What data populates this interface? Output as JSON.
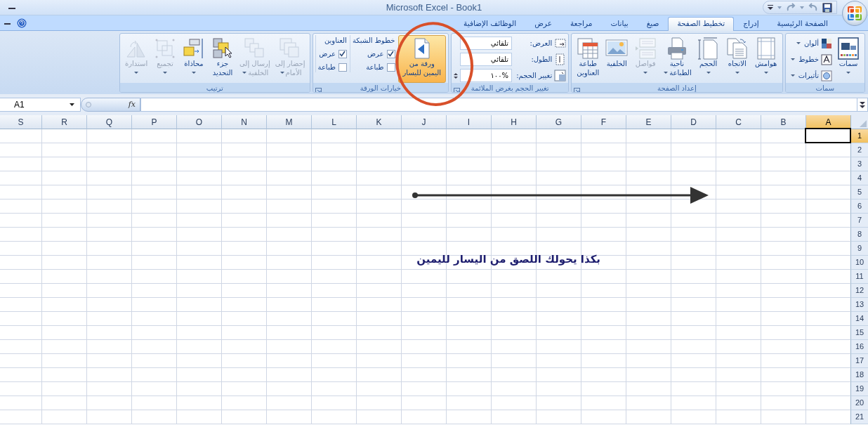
{
  "title_bar": {
    "title": "Microsoft Excel - Book1"
  },
  "tabs": [
    {
      "label": "الصفحة الرئيسية",
      "selected": false
    },
    {
      "label": "إدراج",
      "selected": false
    },
    {
      "label": "تخطيط الصفحة",
      "selected": true
    },
    {
      "label": "صيغ",
      "selected": false
    },
    {
      "label": "بيانات",
      "selected": false
    },
    {
      "label": "مراجعة",
      "selected": false
    },
    {
      "label": "عرض",
      "selected": false
    },
    {
      "label": "الوظائف الإضافية",
      "selected": false
    }
  ],
  "ribbon": {
    "groups": [
      {
        "title": "سمات",
        "launcher": false,
        "items": [
          {
            "kind": "large",
            "label": "سمات",
            "dropdown": true,
            "disabled": false,
            "highlighted": false
          },
          {
            "kind": "stack",
            "entries": [
              {
                "label": "ألوان",
                "dropdown": true
              },
              {
                "label": "خطوط",
                "dropdown": true
              },
              {
                "label": "تأثيرات",
                "dropdown": true
              }
            ]
          }
        ]
      },
      {
        "title": "إعداد الصفحة",
        "launcher": true,
        "items": [
          {
            "kind": "large",
            "label": "هوامش",
            "dropdown": true,
            "disabled": false,
            "highlighted": false
          },
          {
            "kind": "large",
            "label": "الاتجاه",
            "dropdown": true,
            "disabled": false,
            "highlighted": false
          },
          {
            "kind": "large",
            "label": "الحجم",
            "dropdown": true,
            "disabled": false,
            "highlighted": false
          },
          {
            "kind": "large",
            "label": "ناحية\nالطباعة",
            "dropdown": true,
            "disabled": false,
            "highlighted": false
          },
          {
            "kind": "large",
            "label": "فواصل",
            "dropdown": true,
            "disabled": true,
            "highlighted": false
          },
          {
            "kind": "large",
            "label": "الخلفية",
            "dropdown": false,
            "disabled": false,
            "highlighted": false
          },
          {
            "kind": "large",
            "label": "طباعة\nالعناوين",
            "dropdown": false,
            "disabled": false,
            "highlighted": false
          }
        ]
      },
      {
        "title": "تغيير الحجم بغرض الملائمة",
        "launcher": true,
        "items": [
          {
            "kind": "fields",
            "entries": [
              {
                "kind": "select",
                "label": "العرض:",
                "value": "تلقائي"
              },
              {
                "kind": "select",
                "label": "الطول:",
                "value": "تلقائي"
              },
              {
                "kind": "spin",
                "label": "تغيير الحجم:",
                "value": "%١٠٠"
              }
            ]
          }
        ]
      },
      {
        "title": "خيارات الورقة",
        "launcher": true,
        "items": [
          {
            "kind": "large",
            "label": "ورقة من\nاليمين لليسار",
            "dropdown": false,
            "disabled": false,
            "highlighted": true
          },
          {
            "kind": "options",
            "heading": "خطوط الشبكة",
            "entries": [
              {
                "label": "عرض",
                "checked": true
              },
              {
                "label": "طباعة",
                "checked": false
              }
            ]
          },
          {
            "kind": "options",
            "heading": "العناوين",
            "entries": [
              {
                "label": "عرض",
                "checked": true
              },
              {
                "label": "طباعة",
                "checked": false
              }
            ]
          }
        ]
      },
      {
        "title": "ترتيب",
        "launcher": false,
        "items": [
          {
            "kind": "large",
            "label": "إحضار إلى\nالأمام",
            "dropdown": true,
            "disabled": true,
            "highlighted": false
          },
          {
            "kind": "large",
            "label": "إرسال إلى\nالخلفية",
            "dropdown": true,
            "disabled": true,
            "highlighted": false
          },
          {
            "kind": "large",
            "label": "جزء\nالتحديد",
            "dropdown": false,
            "disabled": false,
            "highlighted": false
          },
          {
            "kind": "large",
            "label": "محاذاة",
            "dropdown": true,
            "disabled": false,
            "highlighted": false
          },
          {
            "kind": "large",
            "label": "تجميع",
            "dropdown": true,
            "disabled": true,
            "highlighted": false
          },
          {
            "kind": "large",
            "label": "استدارة",
            "dropdown": true,
            "disabled": true,
            "highlighted": false
          }
        ]
      }
    ]
  },
  "formula_bar": {
    "name_box": "A1",
    "function_button": "fx"
  },
  "sheet": {
    "columns": [
      {
        "label": "A",
        "selected": true
      },
      {
        "label": "B",
        "selected": false
      },
      {
        "label": "C",
        "selected": false
      },
      {
        "label": "D",
        "selected": false
      },
      {
        "label": "E",
        "selected": false
      },
      {
        "label": "F",
        "selected": false
      },
      {
        "label": "G",
        "selected": false
      },
      {
        "label": "H",
        "selected": false
      },
      {
        "label": "I",
        "selected": false
      },
      {
        "label": "J",
        "selected": false
      },
      {
        "label": "K",
        "selected": false
      },
      {
        "label": "L",
        "selected": false
      },
      {
        "label": "M",
        "selected": false
      },
      {
        "label": "N",
        "selected": false
      },
      {
        "label": "O",
        "selected": false
      },
      {
        "label": "P",
        "selected": false
      },
      {
        "label": "Q",
        "selected": false
      },
      {
        "label": "R",
        "selected": false
      },
      {
        "label": "S",
        "selected": false
      }
    ],
    "rows": [
      {
        "label": "1",
        "selected": true
      },
      {
        "label": "2",
        "selected": false
      },
      {
        "label": "3",
        "selected": false
      },
      {
        "label": "4",
        "selected": false
      },
      {
        "label": "5",
        "selected": false
      },
      {
        "label": "6",
        "selected": false
      },
      {
        "label": "7",
        "selected": false
      },
      {
        "label": "8",
        "selected": false
      },
      {
        "label": "9",
        "selected": false
      },
      {
        "label": "10",
        "selected": false
      },
      {
        "label": "11",
        "selected": false
      },
      {
        "label": "12",
        "selected": false
      },
      {
        "label": "13",
        "selected": false
      },
      {
        "label": "14",
        "selected": false
      },
      {
        "label": "15",
        "selected": false
      },
      {
        "label": "16",
        "selected": false
      },
      {
        "label": "17",
        "selected": false
      },
      {
        "label": "18",
        "selected": false
      },
      {
        "label": "19",
        "selected": false
      },
      {
        "label": "20",
        "selected": false
      },
      {
        "label": "21",
        "selected": false
      }
    ],
    "note": "بكذا يحولك اللصق من اليسار لليمين"
  }
}
